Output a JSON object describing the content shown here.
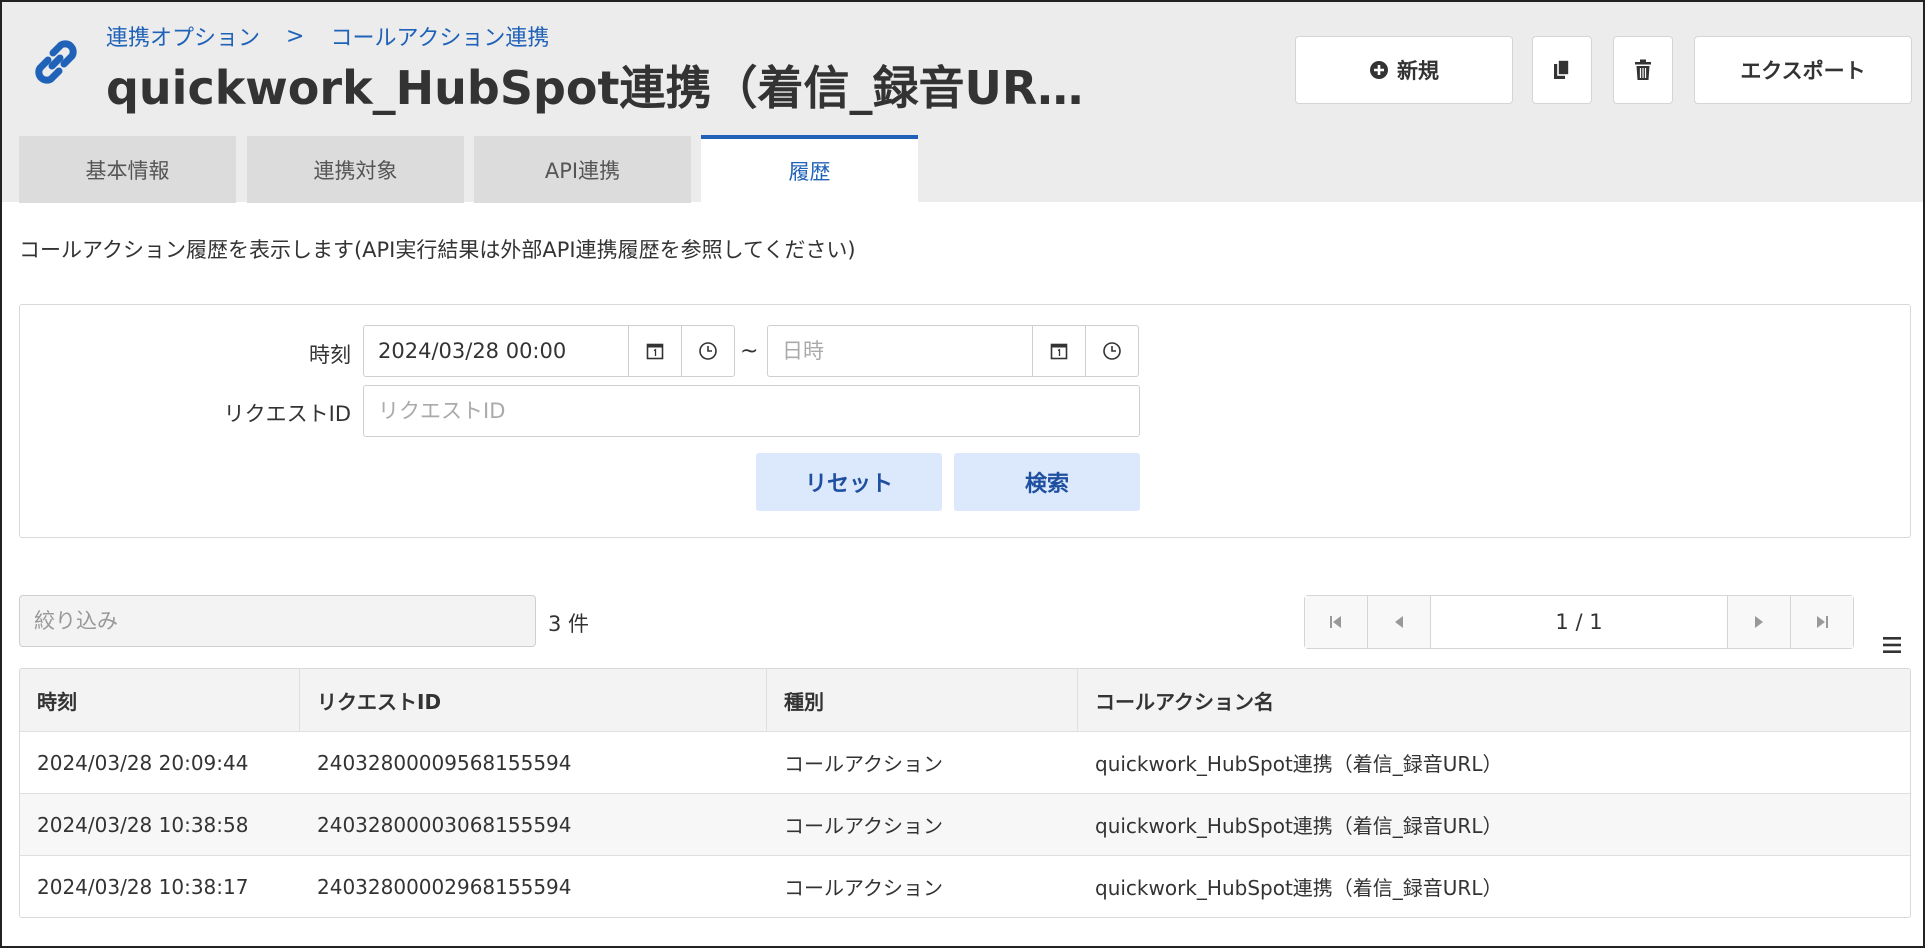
{
  "breadcrumb": {
    "parent": "連携オプション",
    "separator": ">",
    "current": "コールアクション連携"
  },
  "header": {
    "title": "quickwork_HubSpot連携（着信_録音UR…",
    "new_label": "新規",
    "export_label": "エクスポート",
    "icons": {
      "link": "link-icon",
      "new": "plus-circle-icon",
      "copy": "copy-icon",
      "delete": "trash-icon"
    }
  },
  "tabs": [
    {
      "label": "基本情報",
      "active": false
    },
    {
      "label": "連携対象",
      "active": false
    },
    {
      "label": "API連携",
      "active": false
    },
    {
      "label": "履歴",
      "active": true
    }
  ],
  "description": "コールアクション履歴を表示します(API実行結果は外部API連携履歴を参照してください)",
  "search": {
    "time_label": "時刻",
    "from_value": "2024/03/28 00:00",
    "range_separator": "~",
    "to_placeholder": "日時",
    "request_id_label": "リクエストID",
    "request_id_placeholder": "リクエストID",
    "reset_label": "リセット",
    "search_label": "検索"
  },
  "list": {
    "filter_placeholder": "絞り込み",
    "count": "3 件",
    "page_info": "1 / 1"
  },
  "table": {
    "columns": [
      "時刻",
      "リクエストID",
      "種別",
      "コールアクション名"
    ],
    "rows": [
      [
        "2024/03/28 20:09:44",
        "24032800009568155594",
        "コールアクション",
        "quickwork_HubSpot連携（着信_録音URL）"
      ],
      [
        "2024/03/28 10:38:58",
        "24032800003068155594",
        "コールアクション",
        "quickwork_HubSpot連携（着信_録音URL）"
      ],
      [
        "2024/03/28 10:38:17",
        "24032800002968155594",
        "コールアクション",
        "quickwork_HubSpot連携（着信_録音URL）"
      ]
    ]
  },
  "colors": {
    "accent": "#1f62b8",
    "header_bg": "#ececec",
    "button_light": "#dce8fb"
  }
}
